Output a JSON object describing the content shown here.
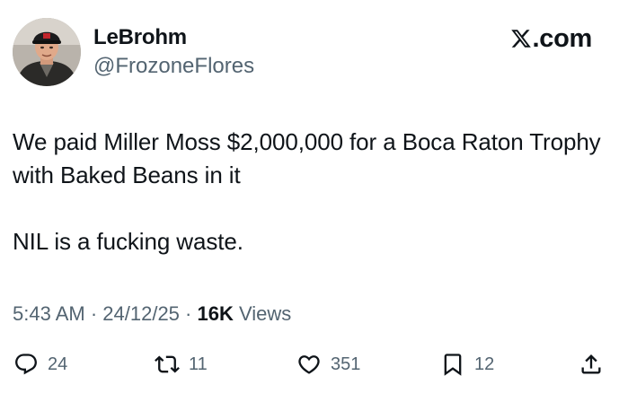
{
  "user": {
    "display_name": "LeBrohm",
    "handle": "@FrozoneFlores"
  },
  "brand": {
    "text": ".com",
    "logo_icon": "x-logo-icon"
  },
  "tweet": {
    "line1": "We paid Miller Moss $2,000,000 for a Boca Raton Trophy with Baked Beans in it",
    "line2": "NIL is a fucking waste."
  },
  "meta": {
    "time": "5:43 AM",
    "sep1": " · ",
    "date": "24/12/25",
    "sep2": " · ",
    "views_count": "16K",
    "views_label": " Views"
  },
  "actions": {
    "replies": "24",
    "reposts": "11",
    "likes": "351",
    "bookmarks": "12"
  },
  "colors": {
    "text": "#0f1419",
    "secondary": "#536471",
    "background": "#ffffff"
  }
}
